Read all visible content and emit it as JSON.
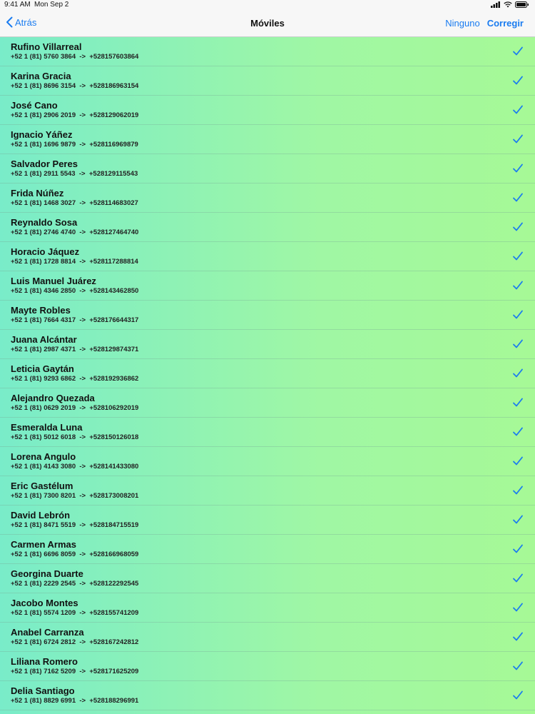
{
  "status": {
    "time": "9:41 AM",
    "date": "Mon Sep 2"
  },
  "nav": {
    "back_label": "Atrás",
    "title": "Móviles",
    "none_label": "Ninguno",
    "edit_label": "Corregir"
  },
  "colors": {
    "accent": "#1a7cf0",
    "gradient_left": "#79ecc9",
    "gradient_right": "#a6f996"
  },
  "contacts": [
    {
      "name": "Rufino Villarreal",
      "phone": "+52 1 (81) 5760 3864  ->  +528157603864",
      "checked": true
    },
    {
      "name": "Karina Gracia",
      "phone": "+52 1 (81) 8696 3154  ->  +528186963154",
      "checked": true
    },
    {
      "name": "José Cano",
      "phone": "+52 1 (81) 2906 2019  ->  +528129062019",
      "checked": true
    },
    {
      "name": "Ignacio Yáñez",
      "phone": "+52 1 (81) 1696 9879  ->  +528116969879",
      "checked": true
    },
    {
      "name": "Salvador Peres",
      "phone": "+52 1 (81) 2911 5543  ->  +528129115543",
      "checked": true
    },
    {
      "name": "Frida Núñez",
      "phone": "+52 1 (81) 1468 3027  ->  +528114683027",
      "checked": true
    },
    {
      "name": "Reynaldo Sosa",
      "phone": "+52 1 (81) 2746 4740  ->  +528127464740",
      "checked": true
    },
    {
      "name": "Horacio Jáquez",
      "phone": "+52 1 (81) 1728 8814  ->  +528117288814",
      "checked": true
    },
    {
      "name": "Luis Manuel Juárez",
      "phone": "+52 1 (81) 4346 2850  ->  +528143462850",
      "checked": true
    },
    {
      "name": "Mayte Robles",
      "phone": "+52 1 (81) 7664 4317  ->  +528176644317",
      "checked": true
    },
    {
      "name": "Juana Alcántar",
      "phone": "+52 1 (81) 2987 4371  ->  +528129874371",
      "checked": true
    },
    {
      "name": "Leticia Gaytán",
      "phone": "+52 1 (81) 9293 6862  ->  +528192936862",
      "checked": true
    },
    {
      "name": "Alejandro Quezada",
      "phone": "+52 1 (81) 0629 2019  ->  +528106292019",
      "checked": true
    },
    {
      "name": "Esmeralda Luna",
      "phone": "+52 1 (81) 5012 6018  ->  +528150126018",
      "checked": true
    },
    {
      "name": "Lorena Angulo",
      "phone": "+52 1 (81) 4143 3080  ->  +528141433080",
      "checked": true
    },
    {
      "name": "Eric Gastélum",
      "phone": "+52 1 (81) 7300 8201  ->  +528173008201",
      "checked": true
    },
    {
      "name": "David Lebrón",
      "phone": "+52 1 (81) 8471 5519  ->  +528184715519",
      "checked": true
    },
    {
      "name": "Carmen Armas",
      "phone": "+52 1 (81) 6696 8059  ->  +528166968059",
      "checked": true
    },
    {
      "name": "Georgina Duarte",
      "phone": "+52 1 (81) 2229 2545  ->  +528122292545",
      "checked": true
    },
    {
      "name": "Jacobo Montes",
      "phone": "+52 1 (81) 5574 1209  ->  +528155741209",
      "checked": true
    },
    {
      "name": "Anabel Carranza",
      "phone": "+52 1 (81) 6724 2812  ->  +528167242812",
      "checked": true
    },
    {
      "name": "Liliana Romero",
      "phone": "+52 1 (81) 7162 5209  ->  +528171625209",
      "checked": true
    },
    {
      "name": "Delia Santiago",
      "phone": "+52 1 (81) 8829 6991  ->  +528188296991",
      "checked": true
    }
  ]
}
